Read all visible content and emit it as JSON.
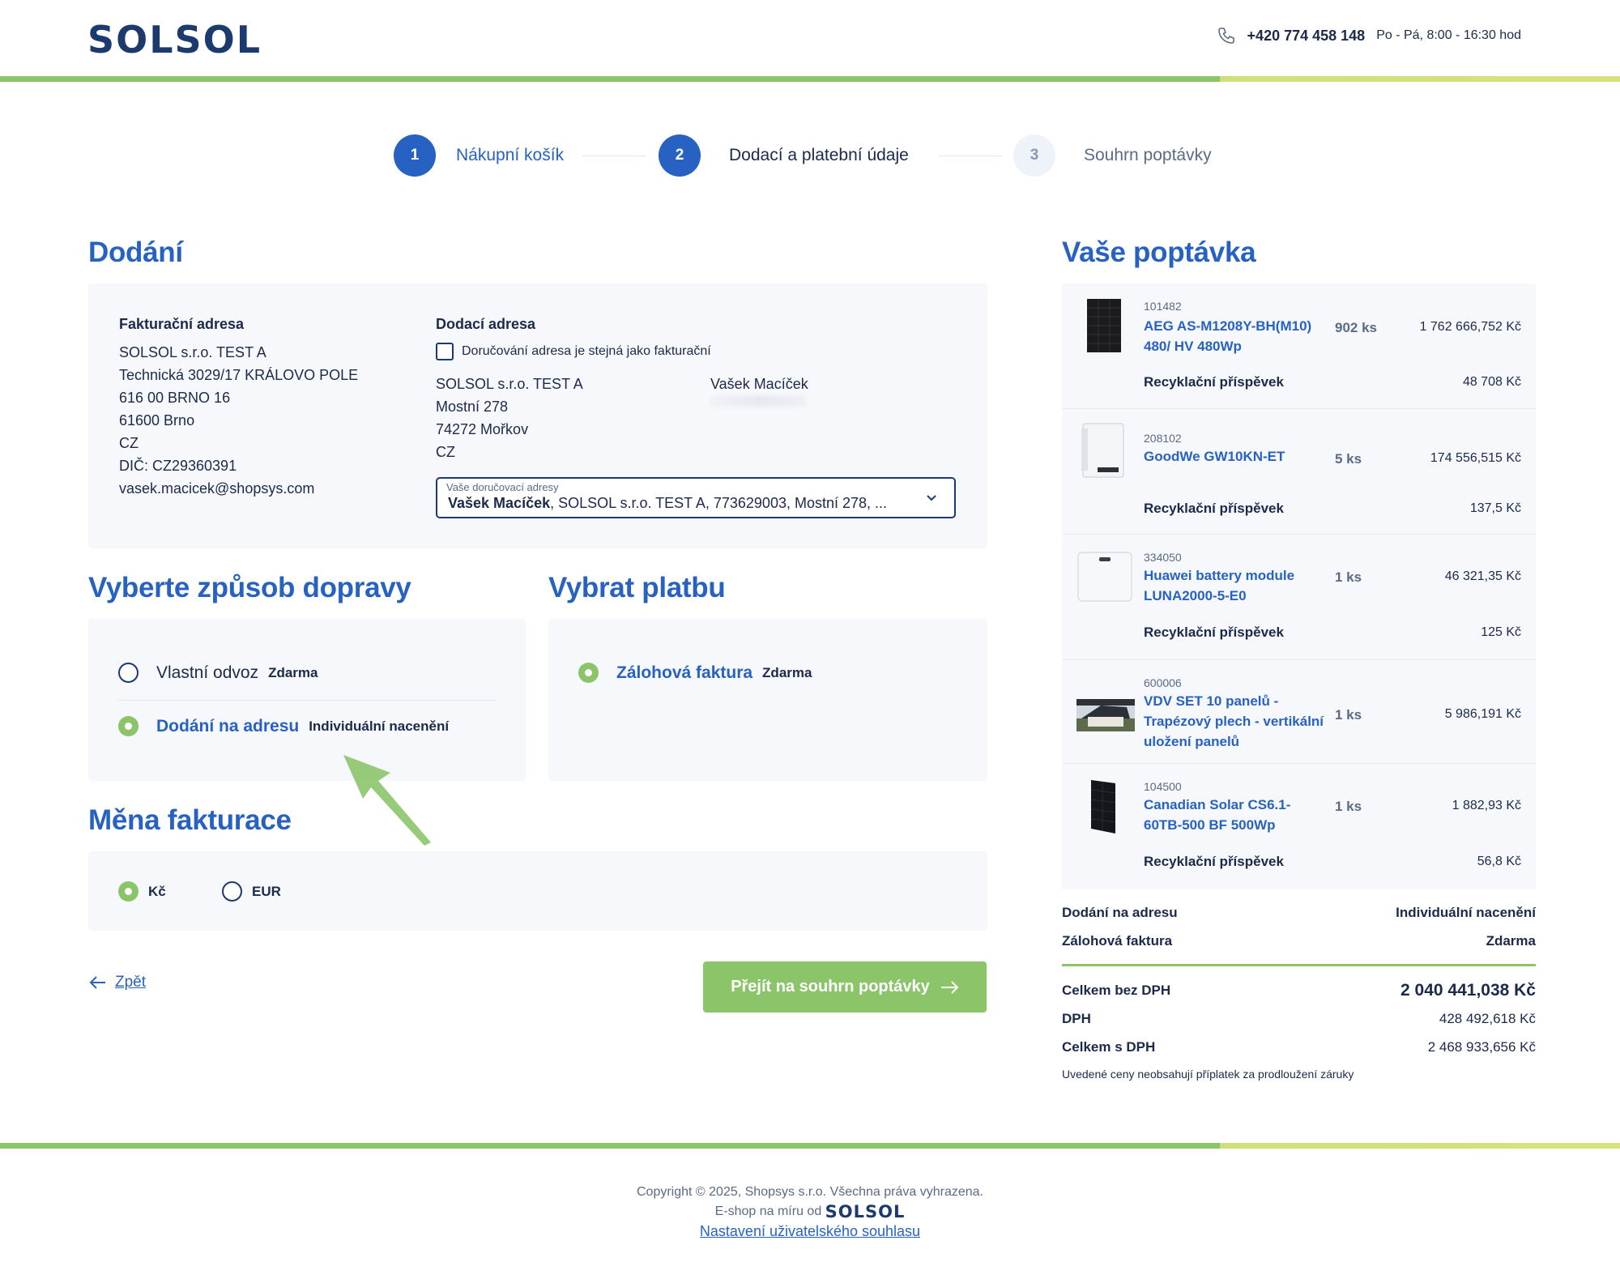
{
  "header": {
    "logo": "SOLSOL",
    "phone": "+420 774 458 148",
    "hours": "Po - Pá, 8:00 - 16:30 hod"
  },
  "stepper": [
    {
      "number": "1",
      "label": "Nákupní košík"
    },
    {
      "number": "2",
      "label": "Dodací a platební údaje"
    },
    {
      "number": "3",
      "label": "Souhrn poptávky"
    }
  ],
  "delivery": {
    "title": "Dodání",
    "billing": {
      "heading": "Fakturační adresa",
      "lines": [
        "SOLSOL s.r.o. TEST A",
        "Technická 3029/17 KRÁLOVO POLE",
        "616 00 BRNO 16",
        "61600 Brno",
        "CZ",
        "DIČ: CZ29360391",
        "vasek.macicek@shopsys.com"
      ]
    },
    "shipping": {
      "heading": "Dodací adresa",
      "same_as_billing_label": "Doručování adresa je stejná jako fakturační",
      "lines": [
        "SOLSOL s.r.o. TEST A",
        "Mostní 278",
        "74272 Mořkov",
        "CZ"
      ],
      "contact_name": "Vašek Macíček"
    },
    "address_select": {
      "caption": "Vaše doručovací adresy",
      "value_bold": "Vašek Macíček",
      "value_rest": ", SOLSOL s.r.o. TEST A, 773629003, Mostní 278, ..."
    }
  },
  "transport": {
    "title": "Vyberte způsob dopravy",
    "options": [
      {
        "name": "Vlastní odvoz",
        "price": "Zdarma",
        "selected": false
      },
      {
        "name": "Dodání na adresu",
        "price": "Individuální nacenění",
        "selected": true
      }
    ]
  },
  "payment": {
    "title": "Vybrat platbu",
    "options": [
      {
        "name": "Zálohová faktura",
        "price": "Zdarma",
        "selected": true
      }
    ]
  },
  "currency": {
    "title": "Měna fakturace",
    "options": [
      {
        "name": "Kč",
        "selected": true
      },
      {
        "name": "EUR",
        "selected": false
      }
    ]
  },
  "actions": {
    "back": "Zpět",
    "continue": "Přejít na souhrn poptávky"
  },
  "order": {
    "title": "Vaše poptávka",
    "items": [
      {
        "code": "101482",
        "name": "AEG AS-M1208Y-BH(M10) 480/ HV 480Wp",
        "qty": "902 ks",
        "price": "1 762 666,752 Kč",
        "recycling_label": "Recyklační příspěvek",
        "recycling_price": "48 708 Kč"
      },
      {
        "code": "208102",
        "name": "GoodWe GW10KN-ET",
        "qty": "5 ks",
        "price": "174 556,515 Kč",
        "recycling_label": "Recyklační příspěvek",
        "recycling_price": "137,5 Kč"
      },
      {
        "code": "334050",
        "name": "Huawei battery module LUNA2000-5-E0",
        "qty": "1 ks",
        "price": "46 321,35 Kč",
        "recycling_label": "Recyklační příspěvek",
        "recycling_price": "125 Kč"
      },
      {
        "code": "600006",
        "name": "VDV SET 10 panelů - Trapézový plech - vertikální uložení panelů",
        "qty": "1 ks",
        "price": "5 986,191 Kč"
      },
      {
        "code": "104500",
        "name": "Canadian Solar CS6.1-60TB-500 BF 500Wp",
        "qty": "1 ks",
        "price": "1 882,93 Kč",
        "recycling_label": "Recyklační příspěvek",
        "recycling_price": "56,8 Kč"
      }
    ],
    "shipping_label": "Dodání na adresu",
    "shipping_value": "Individuální nacenění",
    "payment_label": "Zálohová faktura",
    "payment_value": "Zdarma",
    "total_without_vat_label": "Celkem bez DPH",
    "total_without_vat": "2 040 441,038 Kč",
    "vat_label": "DPH",
    "vat": "428 492,618 Kč",
    "total_with_vat_label": "Celkem s DPH",
    "total_with_vat": "2 468 933,656 Kč",
    "note": "Uvedené ceny neobsahují příplatek za prodloužení záruky"
  },
  "footer": {
    "copyright": "Copyright © 2025, Shopsys s.r.o. Všechna práva vyhrazena.",
    "made_by": "E-shop na míru od",
    "made_by_logo": "SOLSOL",
    "consent_link": "Nastavení uživatelského souhlasu"
  },
  "colors": {
    "primary_blue": "#2762c2",
    "navy": "#1d3a6e",
    "accent_green": "#8cc46a",
    "panel_bg": "#f6f8fb"
  }
}
